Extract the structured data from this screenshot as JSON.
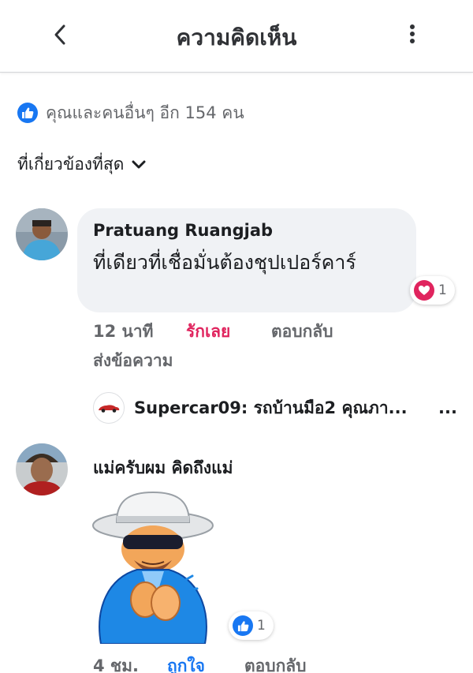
{
  "header": {
    "title": "ความคิดเห็น",
    "back_icon": "chevron-left-icon",
    "more_icon": "vertical-dots-icon"
  },
  "reactions_summary": {
    "icon": "like-icon",
    "text": "คุณและคนอื่นๆ อีก 154 คน"
  },
  "sort": {
    "label": "ที่เกี่ยวข้องที่สุด",
    "icon": "chevron-down-icon"
  },
  "comments": [
    {
      "author": "Pratuang Ruangjab",
      "text": "ที่เดียวที่เชื่อมั่นต้องชุปเปอร์คาร์",
      "reaction": {
        "icon": "love-icon",
        "count": "1",
        "color": "#e0245e"
      },
      "time": "12 นาที",
      "react_label": "รักเลย",
      "reply_label": "ตอบกลับ",
      "message_label": "ส่งข้อความ",
      "reply_preview": {
        "text": "Supercar09: รถบ้านมือ2 คุณภา...",
        "more": "..."
      }
    },
    {
      "author": "แม่ครับผม คิดถึงแม่",
      "sticker": "old-man-clapping-sticker",
      "reaction": {
        "icon": "like-icon",
        "count": "1",
        "color": "#1877f2"
      },
      "time": "4 ชม.",
      "react_label": "ถูกใจ",
      "reply_label": "ตอบกลับ"
    }
  ],
  "colors": {
    "accent": "#1877f2",
    "love": "#e0245e",
    "secondary_text": "#65676b",
    "bubble": "#f0f2f5"
  }
}
